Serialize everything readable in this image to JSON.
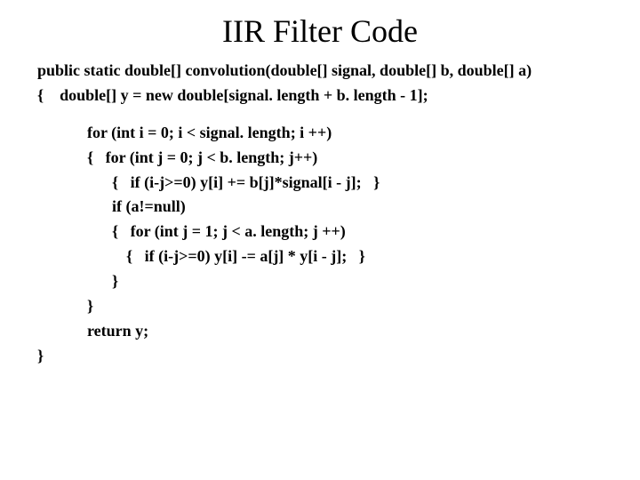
{
  "title": "IIR Filter Code",
  "code": {
    "l1": "public static double[] convolution(double[] signal, double[] b, double[] a)",
    "l2": "{    double[] y = new double[signal. length + b. length - 1];",
    "l3": "for (int i = 0; i < signal. length; i ++)",
    "l4": "{   for (int j = 0; j < b. length; j++)",
    "l5": "{   if (i-j>=0) y[i] += b[j]*signal[i - j];   }",
    "l6": "if (a!=null)",
    "l7": "{   for (int j = 1; j < a. length; j ++)",
    "l8": "{   if (i-j>=0) y[i] -= a[j] * y[i - j];   }",
    "l9": "}",
    "l10": "}",
    "l11": "return y;",
    "l12": "}"
  }
}
